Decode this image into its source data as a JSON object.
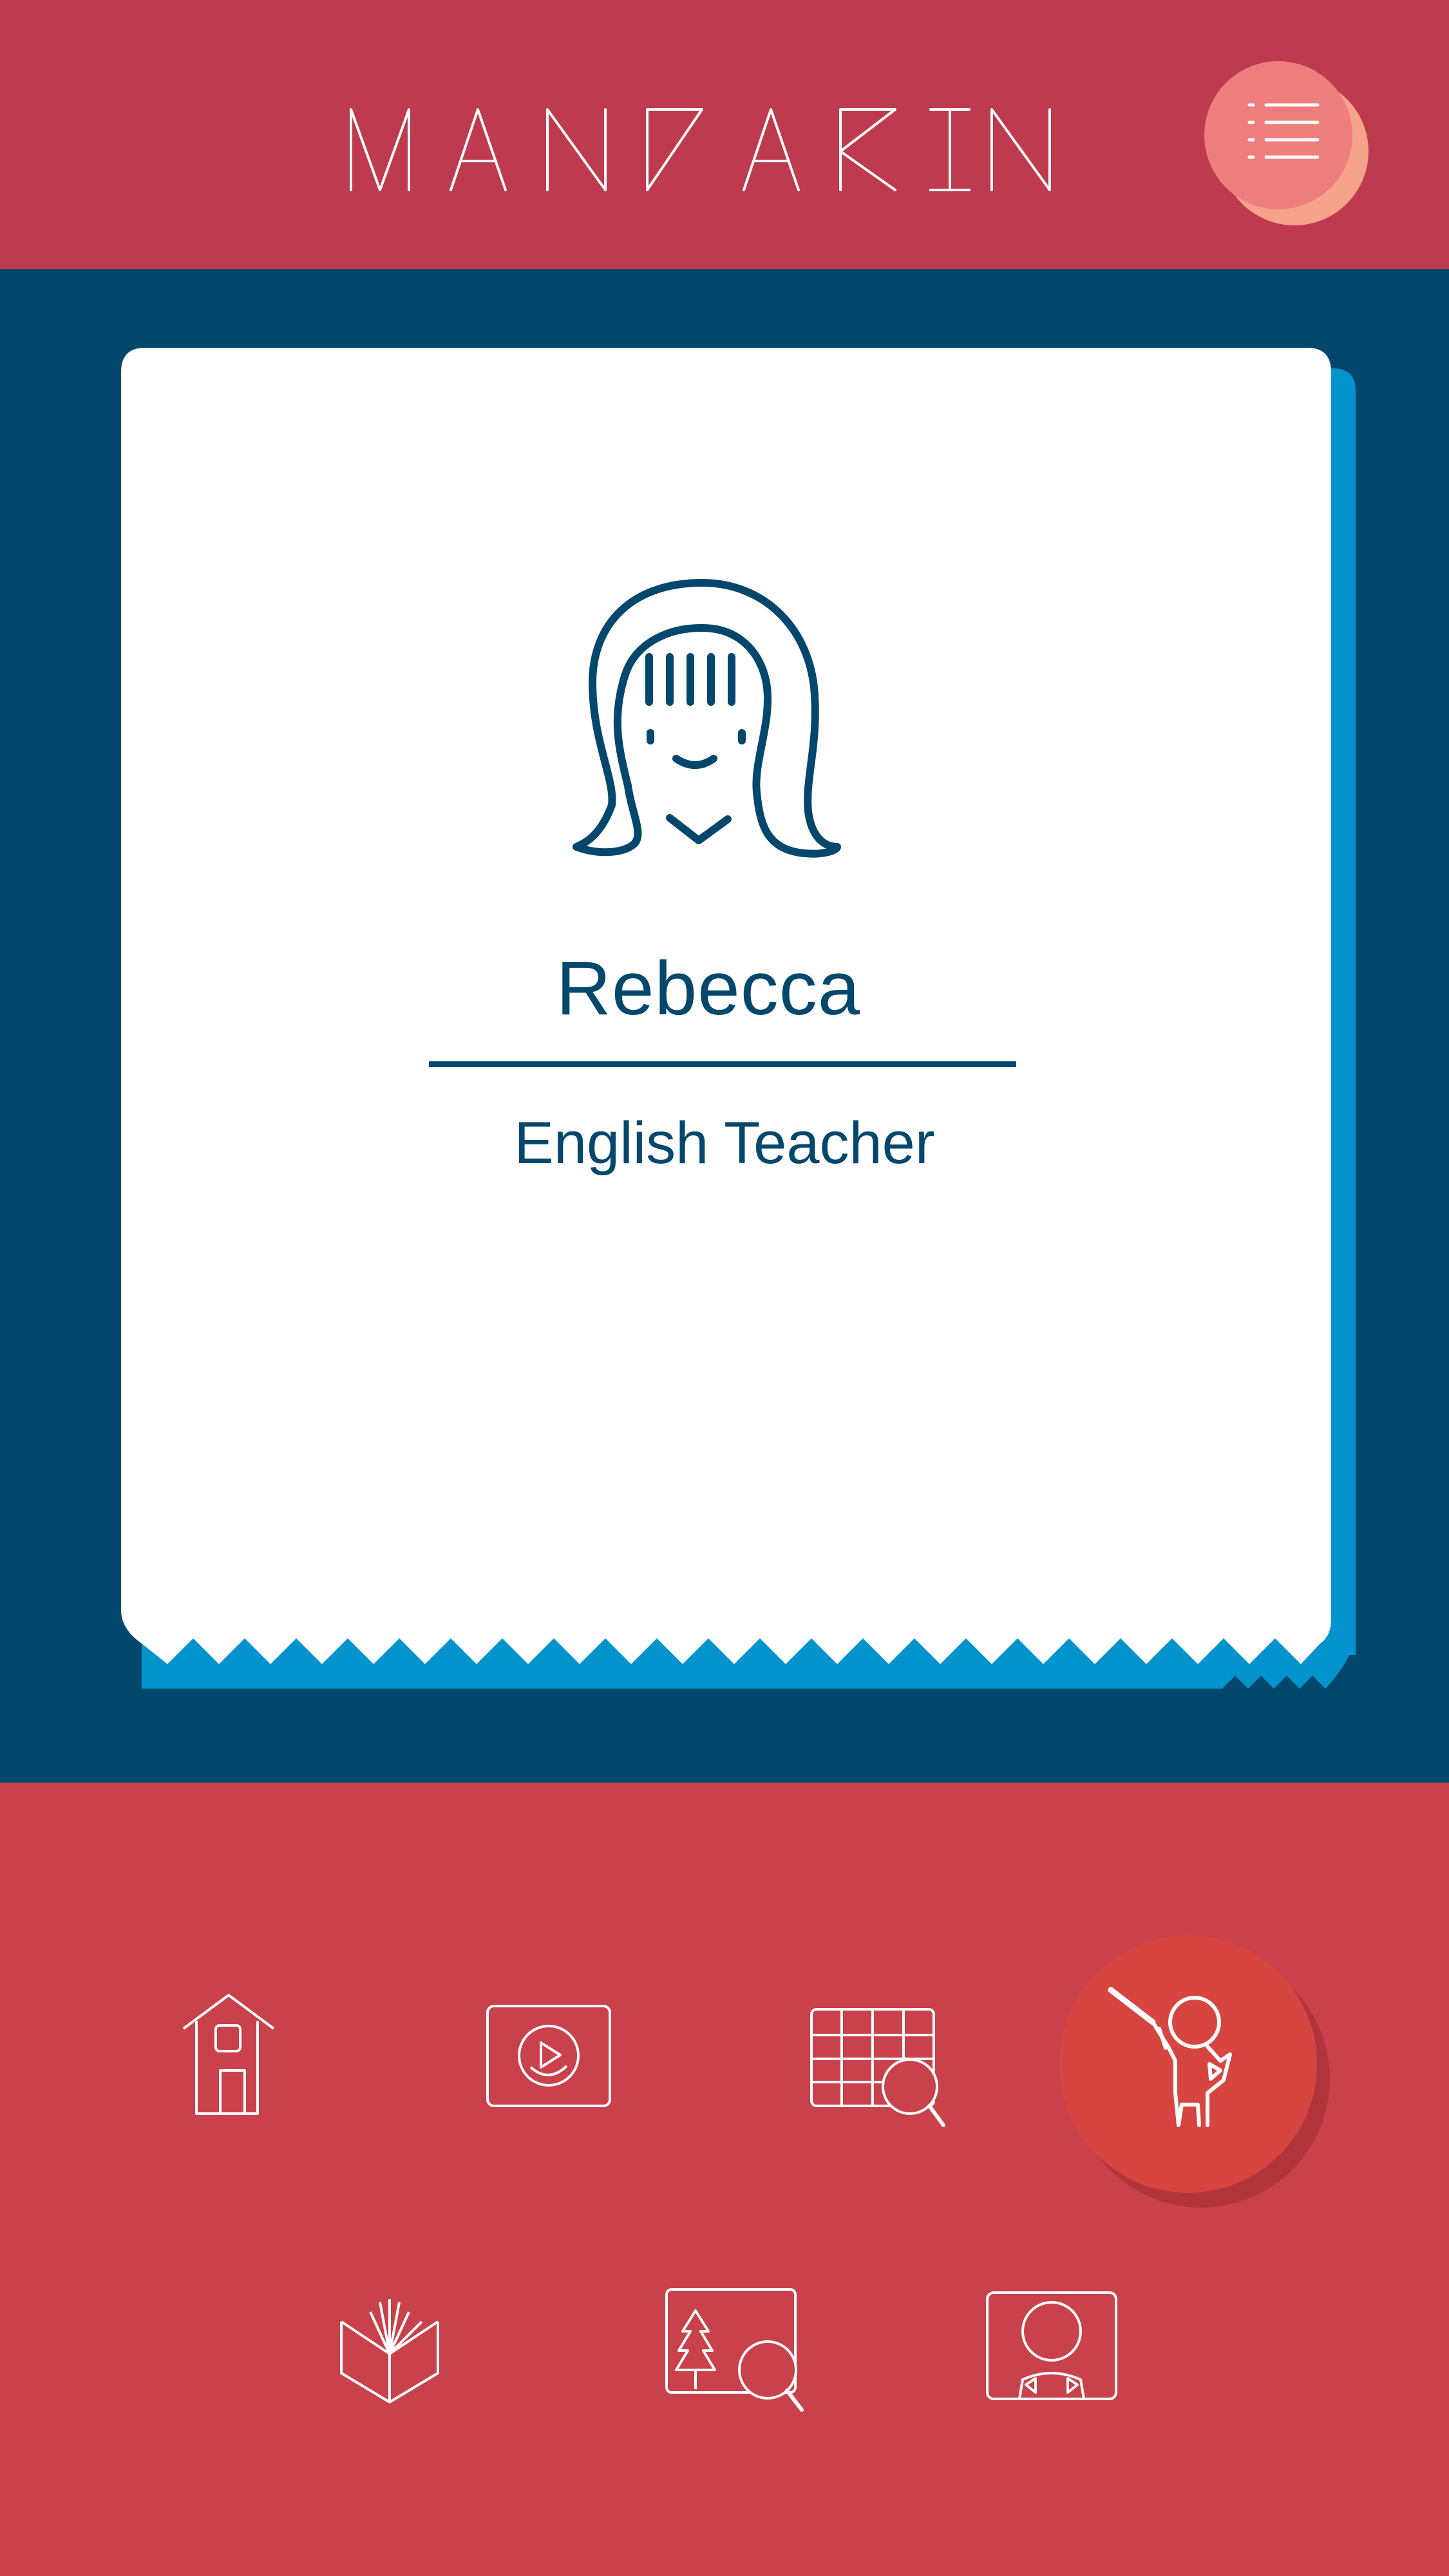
{
  "header": {
    "title": "MANDARIN",
    "menu_icon": "list-menu-icon"
  },
  "profile": {
    "avatar_icon": "girl-face-icon",
    "name": "Rebecca",
    "role": "English Teacher"
  },
  "nav": {
    "items": [
      {
        "icon": "house-icon",
        "selected": false
      },
      {
        "icon": "video-play-icon",
        "selected": false
      },
      {
        "icon": "calendar-search-icon",
        "selected": false
      },
      {
        "icon": "teacher-pointer-icon",
        "selected": true
      },
      {
        "icon": "open-book-icon",
        "selected": false
      },
      {
        "icon": "image-search-icon",
        "selected": false
      },
      {
        "icon": "profile-card-icon",
        "selected": false
      }
    ]
  },
  "colors": {
    "header_bg": "#BE3A4E",
    "profile_bg": "#03476C",
    "card_accent": "#0394CE",
    "nav_bg": "#C9414A",
    "selected_circle": "#D74541",
    "menu_circle": "#F08080"
  }
}
